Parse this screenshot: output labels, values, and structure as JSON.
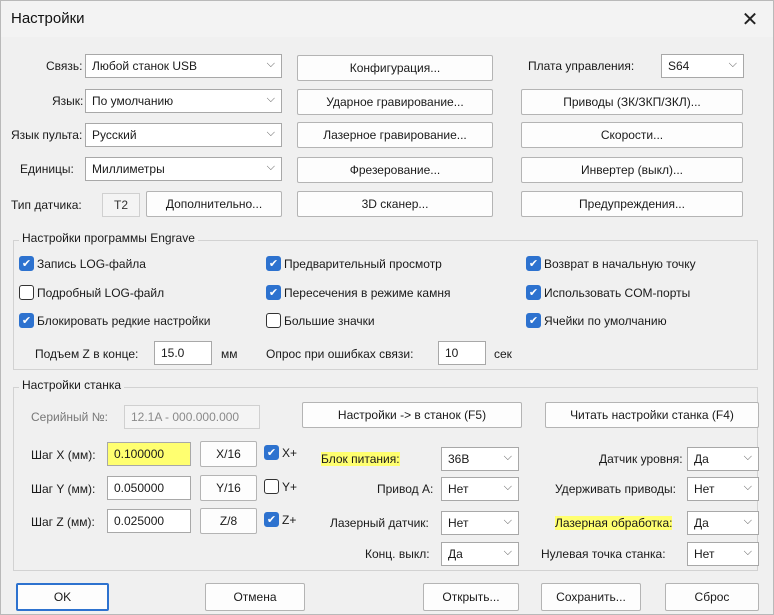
{
  "window": {
    "title": "Настройки"
  },
  "top": {
    "conn_label": "Связь:",
    "conn_value": "Любой станок USB",
    "lang_label": "Язык:",
    "lang_value": "По умолчанию",
    "pult_label": "Язык пульта:",
    "pult_value": "Русский",
    "units_label": "Единицы:",
    "units_value": "Миллиметры",
    "sensor_label": "Тип датчика:",
    "sensor_value": "T2",
    "more_button": "Дополнительно...",
    "mid_buttons": [
      "Конфигурация...",
      "Ударное гравирование...",
      "Лазерное гравирование...",
      "Фрезерование...",
      "3D сканер..."
    ],
    "board_label": "Плата управления:",
    "board_value": "S64",
    "right_buttons": [
      "Приводы (ЗК/ЗКП/ЗКЛ)...",
      "Скорости...",
      "Инвертер (выкл)...",
      "Предупреждения..."
    ]
  },
  "engrave": {
    "title": "Настройки программы Engrave",
    "checkboxes": [
      {
        "label": "Запись LOG-файла",
        "checked": true
      },
      {
        "label": "Подробный LOG-файл",
        "checked": false
      },
      {
        "label": "Блокировать редкие настройки",
        "checked": true
      },
      {
        "label": "Предварительный просмотр",
        "checked": true
      },
      {
        "label": "Пересечения в режиме камня",
        "checked": true
      },
      {
        "label": "Большие значки",
        "checked": false
      },
      {
        "label": "Возврат в начальную точку",
        "checked": true
      },
      {
        "label": "Использовать COM-порты",
        "checked": true
      },
      {
        "label": "Ячейки по умолчанию",
        "checked": true
      }
    ],
    "z_label": "Подъем Z в конце:",
    "z_value": "15.0",
    "z_unit": "мм",
    "poll_label": "Опрос при ошибках связи:",
    "poll_value": "10",
    "poll_unit": "сек"
  },
  "machine": {
    "title": "Настройки станка",
    "serial_label": "Серийный №:",
    "serial_value": "12.1A - 000.000.000",
    "to_machine_button": "Настройки -> в станок (F5)",
    "read_button": "Читать настройки станка (F4)",
    "steps": [
      {
        "label": "Шаг X (мм):",
        "value": "0.100000",
        "button": "X/16",
        "axis": "X+",
        "checked": true
      },
      {
        "label": "Шаг Y (мм):",
        "value": "0.050000",
        "button": "Y/16",
        "axis": "Y+",
        "checked": false
      },
      {
        "label": "Шаг Z (мм):",
        "value": "0.025000",
        "button": "Z/8",
        "axis": "Z+",
        "checked": true
      }
    ],
    "mid_fields": [
      {
        "label": "Блок питания:",
        "value": "36В"
      },
      {
        "label": "Привод А:",
        "value": "Нет"
      },
      {
        "label": "Лазерный датчик:",
        "value": "Нет"
      },
      {
        "label": "Конц. выкл:",
        "value": "Да"
      }
    ],
    "right_fields": [
      {
        "label": "Датчик уровня:",
        "value": "Да"
      },
      {
        "label": "Удерживать приводы:",
        "value": "Нет"
      },
      {
        "label": "Лазерная обработка:",
        "value": "Да"
      },
      {
        "label": "Нулевая точка станка:",
        "value": "Нет"
      }
    ]
  },
  "footer": {
    "ok": "OK",
    "cancel": "Отмена",
    "open": "Открыть...",
    "save": "Сохранить...",
    "reset": "Сброс"
  }
}
